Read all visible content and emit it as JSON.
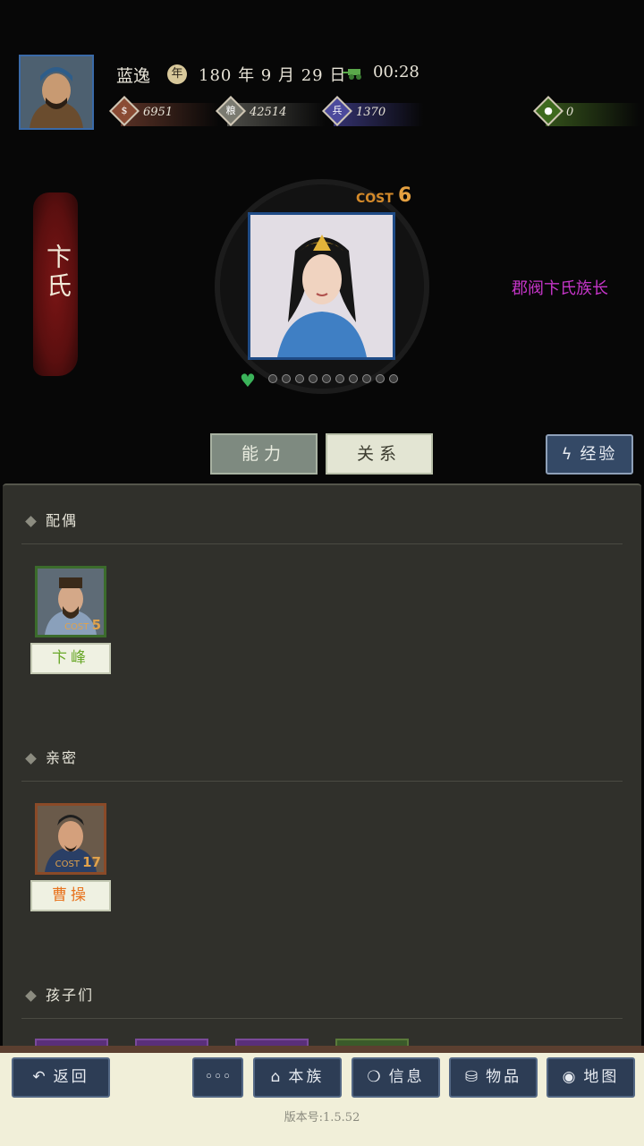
{
  "header": {
    "player_name": "蓝逸",
    "date": "180 年 9 月 29 日",
    "date_icon": "年",
    "clock": "00:28",
    "resources": [
      {
        "name": "gold-icon",
        "glyph": "$",
        "value": "6951",
        "color": "#8a4b34"
      },
      {
        "name": "food-icon",
        "glyph": "粮",
        "value": "42514",
        "color": "#7a7a70"
      },
      {
        "name": "troops-icon",
        "glyph": "兵",
        "value": "1370",
        "color": "#4c4a9c"
      },
      {
        "name": "gem-icon",
        "glyph": "●",
        "value": "0",
        "color": "#3e6a1e"
      }
    ]
  },
  "hero": {
    "name": "卞氏",
    "cost_label": "COST",
    "cost": "6",
    "title": "郡阀卞氏族长",
    "stars_total": 10,
    "stars_filled": 0
  },
  "tabs": {
    "ability": "能力",
    "relations": "关系",
    "exp_button": "经验"
  },
  "sections": {
    "spouse": {
      "title": "配偶",
      "characters": [
        {
          "name": "卞峰",
          "cost_label": "COST",
          "cost": "5",
          "name_color": "#6aa82a",
          "border": "#3b6b2b"
        }
      ]
    },
    "kin": {
      "title": "亲密",
      "characters": [
        {
          "name": "曹操",
          "cost_label": "COST",
          "cost": "17",
          "name_color": "#e8741f",
          "border": "#8a4a28"
        }
      ]
    },
    "children": {
      "title": "孩子们"
    }
  },
  "bottom_nav": {
    "back": "返回",
    "more": "◦◦◦",
    "clan": "本族",
    "info": "信息",
    "items": "物品",
    "map": "地图"
  },
  "version": "版本号:1.5.52",
  "colors": {
    "panel": "#30302b",
    "button_blue": "#2d3d55",
    "title_magenta": "#c535c8",
    "banner_red": "#7a1515"
  }
}
